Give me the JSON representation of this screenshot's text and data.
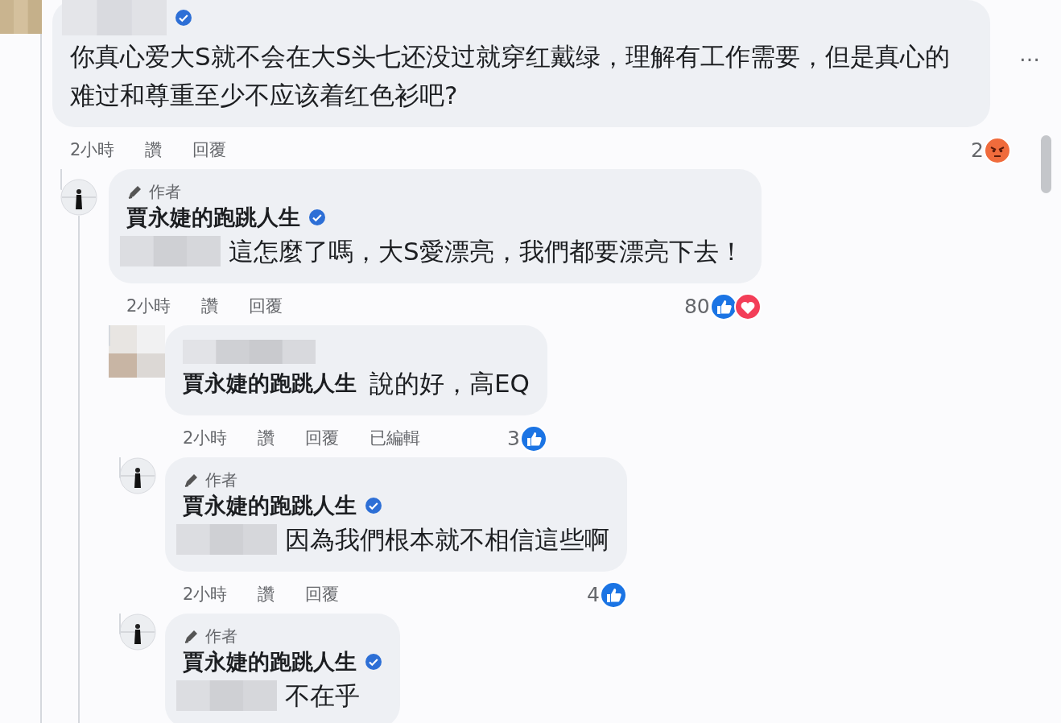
{
  "comments": [
    {
      "kind": "comment",
      "verified": true,
      "text": "你真心爱大S就不会在大S头七还没过就穿红戴绿，理解有工作需要，但是真心的难过和尊重至少不应该着红色衫吧?",
      "more": "…",
      "time": "2小時",
      "actions": [
        "讚",
        "回覆"
      ],
      "reaction_count": "2",
      "reactions": [
        {
          "kind": "angry"
        }
      ],
      "replies": [
        {
          "kind": "author",
          "badge": "作者",
          "name": "賈永婕的跑跳人生",
          "verified": true,
          "text": "這怎麼了嗎，大S愛漂亮，我們都要漂亮下去！",
          "time": "2小時",
          "actions": [
            "讚",
            "回覆"
          ],
          "reaction_count": "80",
          "reactions": [
            {
              "kind": "like"
            },
            {
              "kind": "love"
            }
          ],
          "replies": [
            {
              "kind": "reply",
              "mention": "賈永婕的跑跳人生",
              "text": "說的好，高EQ",
              "time": "2小時",
              "actions": [
                "讚",
                "回覆",
                "已編輯"
              ],
              "reaction_count": "3",
              "reactions": [
                {
                  "kind": "like"
                }
              ]
            },
            {
              "kind": "author",
              "badge": "作者",
              "name": "賈永婕的跑跳人生",
              "verified": true,
              "text": "因為我們根本就不相信這些啊",
              "time": "2小時",
              "actions": [
                "讚",
                "回覆"
              ],
              "reaction_count": "4",
              "reactions": [
                {
                  "kind": "like"
                }
              ]
            },
            {
              "kind": "author",
              "badge": "作者",
              "name": "賈永婕的跑跳人生",
              "verified": true,
              "text": "不在乎"
            }
          ]
        }
      ]
    }
  ]
}
